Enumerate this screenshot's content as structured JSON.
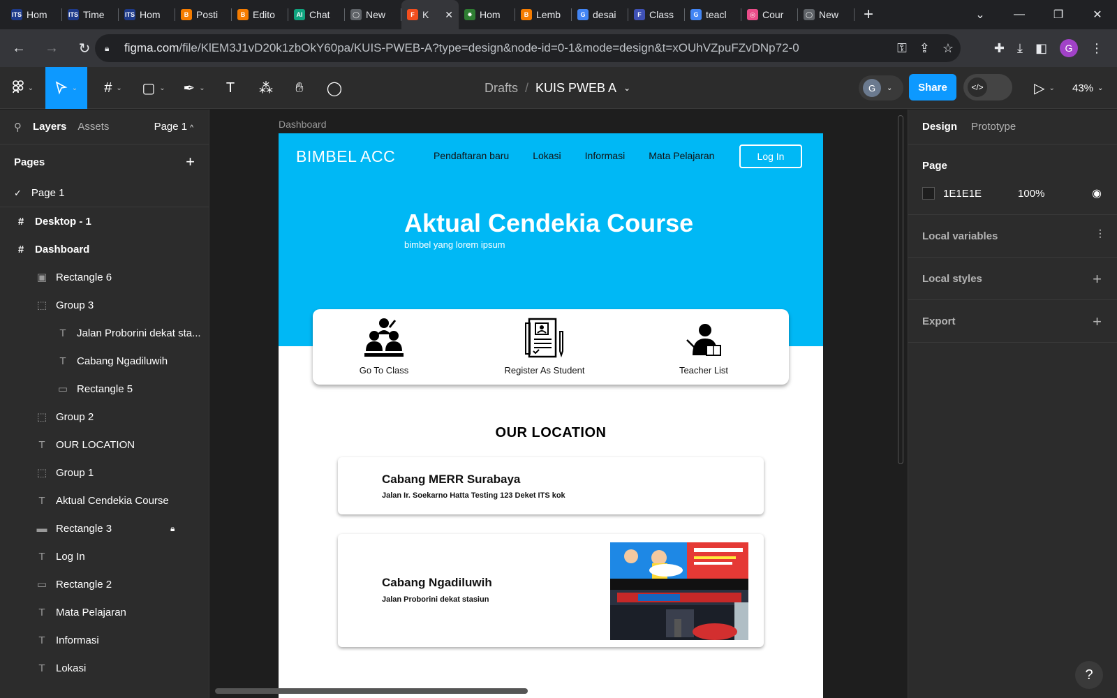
{
  "browser": {
    "tabs": [
      {
        "label": "Hom",
        "fav": "ITS",
        "color": "#1e3a8a"
      },
      {
        "label": "Time",
        "fav": "ITS",
        "color": "#1e3a8a"
      },
      {
        "label": "Hom",
        "fav": "ITS",
        "color": "#1e3a8a"
      },
      {
        "label": "Posti",
        "fav": "B",
        "color": "#f57c00"
      },
      {
        "label": "Edito",
        "fav": "B",
        "color": "#f57c00"
      },
      {
        "label": "Chat",
        "fav": "AI",
        "color": "#10a37f"
      },
      {
        "label": "New",
        "fav": "◯",
        "color": "#5f6368"
      },
      {
        "label": "K",
        "fav": "F",
        "color": "#f24e1e",
        "active": true
      },
      {
        "label": "Hom",
        "fav": "✸",
        "color": "#2e7d32"
      },
      {
        "label": "Lemb",
        "fav": "B",
        "color": "#f57c00"
      },
      {
        "label": "desai",
        "fav": "G",
        "color": "#4285f4"
      },
      {
        "label": "Class",
        "fav": "F",
        "color": "#3f51b5"
      },
      {
        "label": "teacl",
        "fav": "G",
        "color": "#4285f4"
      },
      {
        "label": "Cour",
        "fav": "◎",
        "color": "#ea4c89"
      },
      {
        "label": "New",
        "fav": "◯",
        "color": "#5f6368"
      }
    ],
    "url_host": "figma.com",
    "url_path": "/file/KlEM3J1vD20k1zbOkY60pa/KUIS-PWEB-A?type=design&node-id=0-1&mode=design&t=xOUhVZpuFZvDNp72-0",
    "profile_initial": "G"
  },
  "figma": {
    "breadcrumb_drafts": "Drafts",
    "breadcrumb_sep": "/",
    "file_name": "KUIS PWEB A",
    "share_label": "Share",
    "collab_initial": "G",
    "zoom": "43%",
    "left_tabs": {
      "layers": "Layers",
      "assets": "Assets",
      "page": "Page 1"
    },
    "pages_title": "Pages",
    "pages": [
      "Page 1"
    ],
    "layers": [
      {
        "name": "Desktop - 1",
        "icon": "#",
        "indent": 0,
        "bold": true
      },
      {
        "name": "Dashboard",
        "icon": "#",
        "indent": 0,
        "bold": true
      },
      {
        "name": "Rectangle 6",
        "icon": "▣",
        "indent": 1
      },
      {
        "name": "Group 3",
        "icon": "⬚",
        "indent": 1
      },
      {
        "name": "Jalan Proborini dekat sta...",
        "icon": "T",
        "indent": 2
      },
      {
        "name": "Cabang Ngadiluwih",
        "icon": "T",
        "indent": 2
      },
      {
        "name": "Rectangle 5",
        "icon": "▭",
        "indent": 2
      },
      {
        "name": "Group 2",
        "icon": "⬚",
        "indent": 1
      },
      {
        "name": "OUR LOCATION",
        "icon": "T",
        "indent": 1
      },
      {
        "name": "Group 1",
        "icon": "⬚",
        "indent": 1
      },
      {
        "name": "Aktual Cendekia Course",
        "icon": "T",
        "indent": 1
      },
      {
        "name": "Rectangle 3",
        "icon": "▬",
        "indent": 1,
        "locked": true
      },
      {
        "name": "Log In",
        "icon": "T",
        "indent": 1
      },
      {
        "name": "Rectangle 2",
        "icon": "▭",
        "indent": 1
      },
      {
        "name": "Mata Pelajaran",
        "icon": "T",
        "indent": 1
      },
      {
        "name": "Informasi",
        "icon": "T",
        "indent": 1
      },
      {
        "name": "Lokasi",
        "icon": "T",
        "indent": 1
      }
    ],
    "right_tabs": {
      "design": "Design",
      "prototype": "Prototype"
    },
    "page_section": {
      "title": "Page",
      "bg_hex": "1E1E1E",
      "opacity": "100%"
    },
    "local_variables": "Local variables",
    "local_styles": "Local styles",
    "export": "Export",
    "help": "?"
  },
  "design": {
    "frame_label": "Dashboard",
    "brand": "BIMBEL ACC",
    "nav": [
      "Pendaftaran baru",
      "Lokasi",
      "Informasi",
      "Mata Pelajaran"
    ],
    "login": "Log In",
    "hero_title": "Aktual Cendekia Course",
    "hero_sub": "bimbel yang lorem ipsum",
    "menu": [
      "Go To Class",
      "Register As Student",
      "Teacher List"
    ],
    "location_title": "OUR LOCATION",
    "locations": [
      {
        "name": "Cabang MERR Surabaya",
        "address": "Jalan Ir. Soekarno Hatta Testing 123 Deket ITS kok"
      },
      {
        "name": "Cabang Ngadiluwih",
        "address": "Jalan Proborini dekat stasiun"
      }
    ],
    "colors": {
      "hero": "#00B8F5",
      "figma_accent": "#0D99FF",
      "canvas": "#1E1E1E"
    }
  }
}
